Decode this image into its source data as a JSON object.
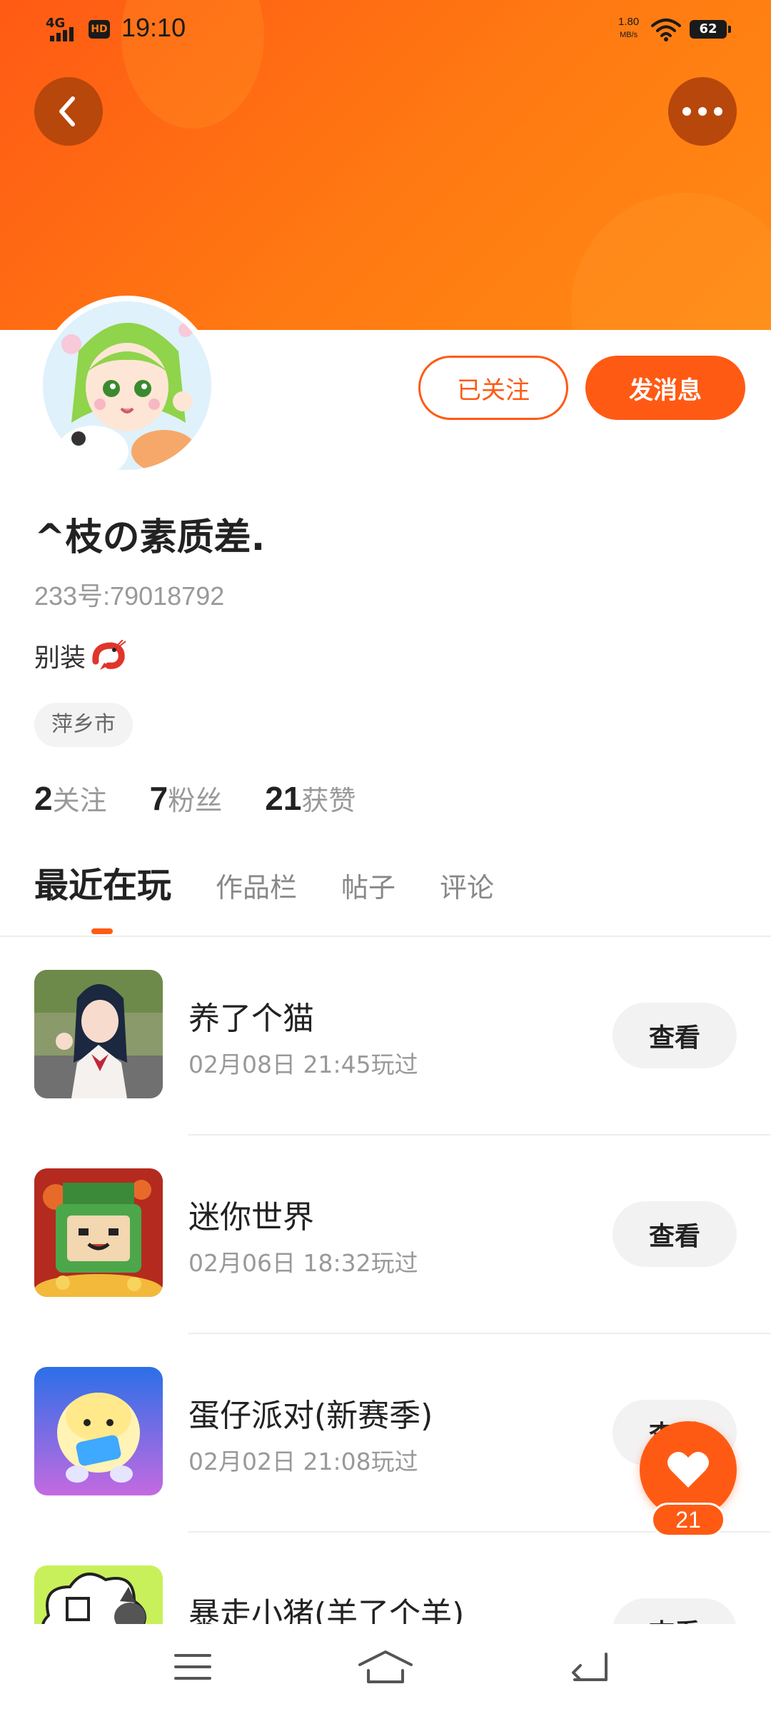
{
  "status_bar": {
    "network": "4G",
    "hd": "HD",
    "time": "19:10",
    "speed_value": "1.80",
    "speed_unit": "MB/s",
    "battery": "62"
  },
  "header": {
    "back_icon": "chevron-left-icon",
    "more_icon": "more-dots-icon"
  },
  "profile": {
    "username": "^枝の素质差.",
    "uid": "233号:79018792",
    "bio": "别装",
    "bio_emoji": "shrimp-emoji",
    "location": "萍乡市",
    "follow_label": "已关注",
    "message_label": "发消息",
    "stats": [
      {
        "num": "2",
        "label": "关注"
      },
      {
        "num": "7",
        "label": "粉丝"
      },
      {
        "num": "21",
        "label": "获赞"
      }
    ]
  },
  "tabs": [
    {
      "label": "最近在玩",
      "active": true
    },
    {
      "label": "作品栏",
      "active": false
    },
    {
      "label": "帖子",
      "active": false
    },
    {
      "label": "评论",
      "active": false
    }
  ],
  "games": [
    {
      "name": "养了个猫",
      "time": "02月08日 21:45玩过",
      "button": "查看"
    },
    {
      "name": "迷你世界",
      "time": "02月06日 18:32玩过",
      "button": "查看"
    },
    {
      "name": "蛋仔派对(新赛季)",
      "time": "02月02日 21:08玩过",
      "button": "查看"
    },
    {
      "name": "暴走小猪(羊了个羊)",
      "time": "",
      "button": "查看"
    }
  ],
  "like": {
    "count": "21",
    "icon": "heart-icon"
  },
  "nav": {
    "menu_icon": "menu-icon",
    "home_icon": "home-icon",
    "back_icon": "back-arrow-icon"
  },
  "colors": {
    "accent": "#ff5a14",
    "header_gradient_start": "#ff5a14",
    "header_gradient_end": "#ff8a14",
    "muted_text": "#999999"
  }
}
